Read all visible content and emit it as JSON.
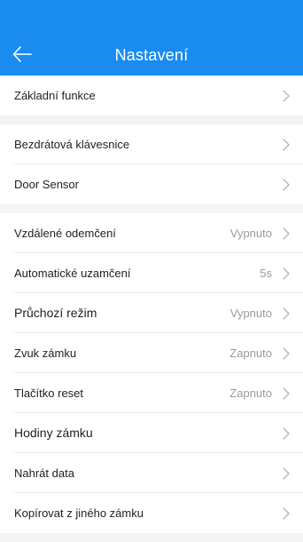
{
  "header": {
    "title": "Nastavení",
    "back_icon": "arrow-left-icon",
    "background_color": "#1a8bf0"
  },
  "groups": [
    {
      "items": [
        {
          "label": "Základní funkce",
          "value": ""
        }
      ]
    },
    {
      "items": [
        {
          "label": "Bezdrátová klávesnice",
          "value": ""
        },
        {
          "label": "Door Sensor",
          "value": ""
        }
      ]
    },
    {
      "items": [
        {
          "label": "Vzdálené odemčení",
          "value": "Vypnuto"
        },
        {
          "label": "Automatické uzamčení",
          "value": "5s"
        },
        {
          "label": "Průchozí režim",
          "value": "Vypnuto"
        },
        {
          "label": "Zvuk zámku",
          "value": "Zapnuto"
        },
        {
          "label": "Tlačítko reset",
          "value": "Zapnuto"
        },
        {
          "label": "Hodiny zámku",
          "value": ""
        },
        {
          "label": "Nahrát data",
          "value": ""
        },
        {
          "label": "Kopírovat z jiného zámku",
          "value": ""
        }
      ]
    }
  ],
  "chevron_icon": "chevron-right-icon"
}
